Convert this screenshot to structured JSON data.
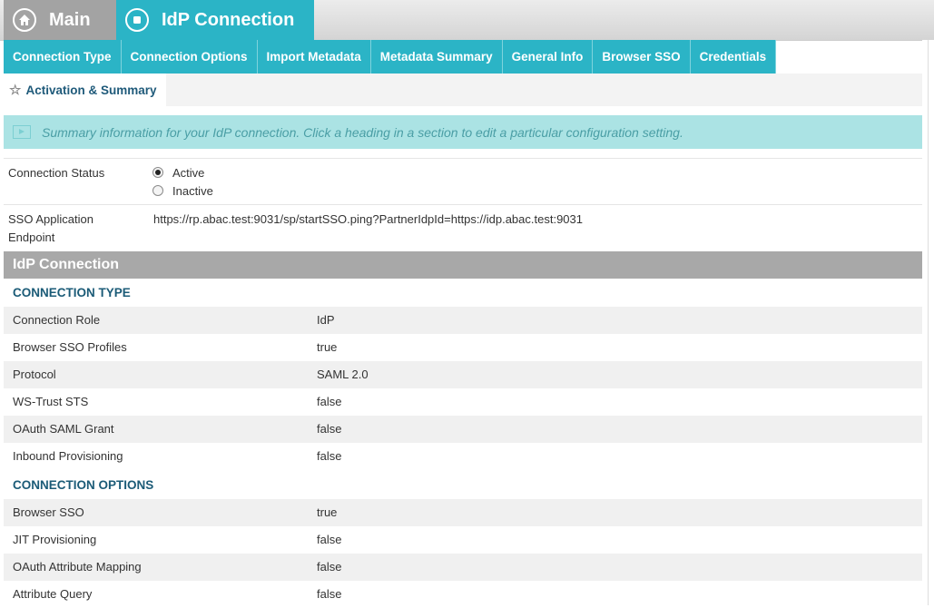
{
  "top_tabs": {
    "main": "Main",
    "idp": "IdP Connection"
  },
  "sub_tabs": [
    "Connection Type",
    "Connection Options",
    "Import Metadata",
    "Metadata Summary",
    "General Info",
    "Browser SSO",
    "Credentials"
  ],
  "activation_tab": "Activation & Summary",
  "banner": "Summary information for your IdP connection. Click a heading in a section to edit a particular configuration setting.",
  "status": {
    "label": "Connection Status",
    "options": [
      "Active",
      "Inactive"
    ],
    "selected": "Active"
  },
  "endpoint": {
    "label_line1": "SSO Application",
    "label_line2": "Endpoint",
    "value": "https://rp.abac.test:9031/sp/startSSO.ping?PartnerIdpId=https://idp.abac.test:9031"
  },
  "section_title": "IdP Connection",
  "connection_type": {
    "heading": "CONNECTION TYPE",
    "rows": [
      {
        "k": "Connection Role",
        "v": "IdP"
      },
      {
        "k": "Browser SSO Profiles",
        "v": "true"
      },
      {
        "k": "Protocol",
        "v": "SAML 2.0"
      },
      {
        "k": "WS-Trust STS",
        "v": "false"
      },
      {
        "k": "OAuth SAML Grant",
        "v": "false"
      },
      {
        "k": "Inbound Provisioning",
        "v": "false"
      }
    ]
  },
  "connection_options": {
    "heading": "CONNECTION OPTIONS",
    "rows": [
      {
        "k": "Browser SSO",
        "v": "true"
      },
      {
        "k": "JIT Provisioning",
        "v": "false"
      },
      {
        "k": "OAuth Attribute Mapping",
        "v": "false"
      },
      {
        "k": "Attribute Query",
        "v": "false"
      }
    ]
  },
  "colors": {
    "accent": "#2bb4c6",
    "banner_bg": "#abe3e4",
    "section_bg": "#a8a8a8"
  }
}
